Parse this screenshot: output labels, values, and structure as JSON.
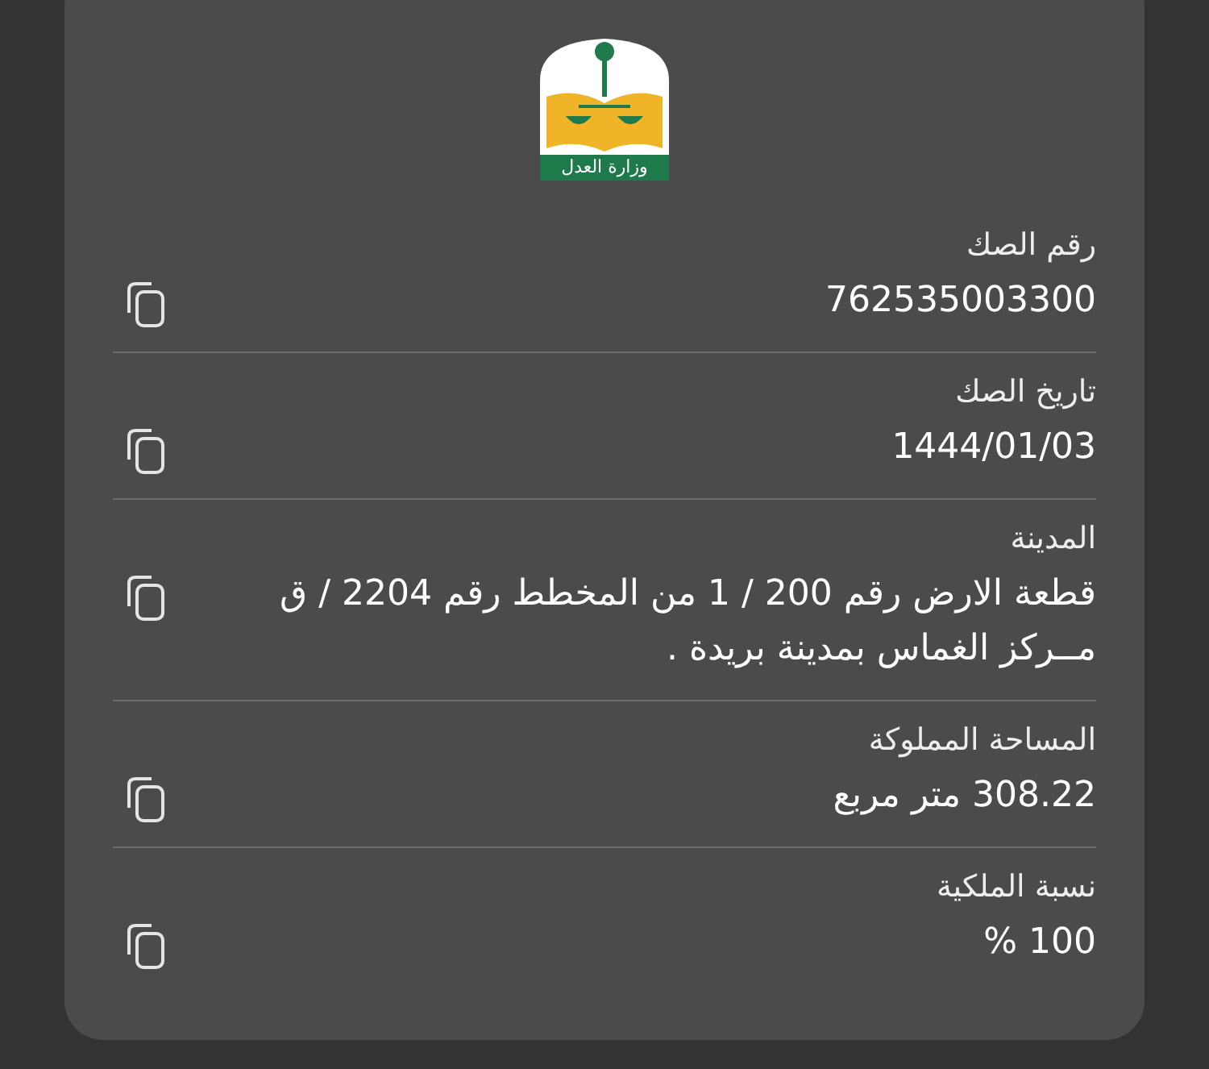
{
  "logo": {
    "text": "وزارة العدل"
  },
  "fields": [
    {
      "label": "رقم الصك",
      "value": "762535003300"
    },
    {
      "label": "تاريخ الصك",
      "value": "1444/01/03"
    },
    {
      "label": "المدينة",
      "value": "قطعة الارض  رقم 200 / 1 من المخطط رقم  2204 / ق مــركز الغماس  بمدينة بريدة ."
    },
    {
      "label": "المساحة المملوكة",
      "value": "308.22 متر مربع"
    },
    {
      "label": "نسبة الملكية",
      "value": "100 %"
    }
  ]
}
